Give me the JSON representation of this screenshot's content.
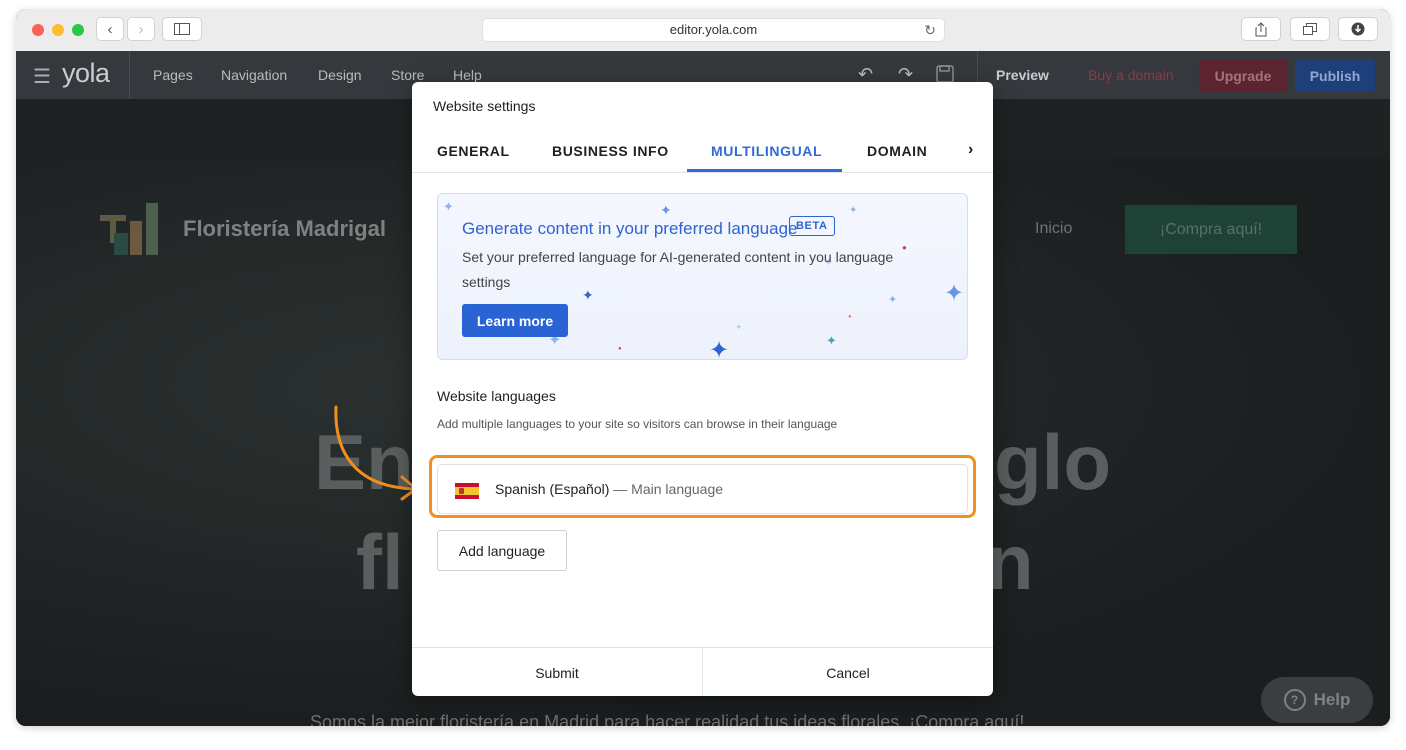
{
  "browser": {
    "url": "editor.yola.com"
  },
  "editor": {
    "logo": "yola",
    "menu": [
      "Pages",
      "Navigation",
      "Design",
      "Store",
      "Help"
    ],
    "preview": "Preview",
    "buy_domain": "Buy a domain",
    "upgrade": "Upgrade",
    "publish": "Publish"
  },
  "site": {
    "brand": "Floristería Madrigal",
    "nav_home": "Inicio",
    "cta": "¡Compra aquí!",
    "hero_left_1": "En",
    "hero_right_1": "glo",
    "hero_left_2": "fl",
    "hero_right_2": "n",
    "subtitle": "Somos la mejor floristería en Madrid para hacer realidad tus ideas florales. ¡Compra aquí!",
    "help": "Help"
  },
  "modal": {
    "title": "Website settings",
    "tabs": [
      "GENERAL",
      "BUSINESS INFO",
      "MULTILINGUAL",
      "DOMAIN"
    ],
    "active_tab": "MULTILINGUAL",
    "banner": {
      "title": "Generate content in your preferred language",
      "badge": "BETA",
      "text": "Set your preferred language for AI-generated content in you language settings",
      "button": "Learn more"
    },
    "languages": {
      "title": "Website languages",
      "subtitle": "Add multiple languages to your site so visitors can browse in their language",
      "items": [
        {
          "name": "Spanish (Español)",
          "note": "— Main language"
        }
      ],
      "add_button": "Add language"
    },
    "submit": "Submit",
    "cancel": "Cancel"
  },
  "colors": {
    "accent": "#2f6bd6",
    "highlight": "#f1901f",
    "publish": "#1f3f7a",
    "upgrade": "#6b1f2e"
  }
}
